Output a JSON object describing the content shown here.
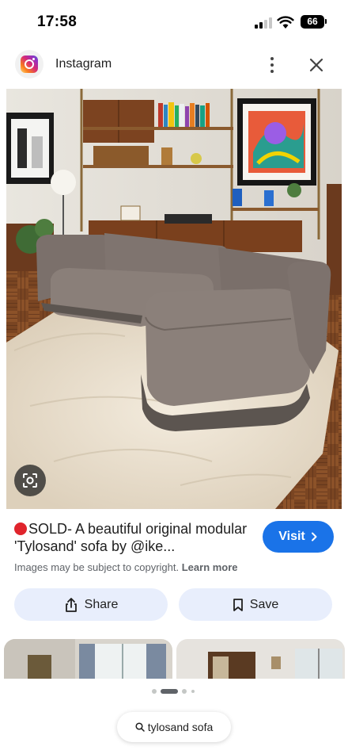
{
  "status_bar": {
    "time": "17:58",
    "battery": "66"
  },
  "source": {
    "name": "Instagram",
    "logo_icon": "instagram-logo"
  },
  "result": {
    "title": "SOLD- A beautiful original modular 'Tylosand' sofa by @ike...",
    "visit_label": "Visit",
    "copyright_text": "Images may be subject to copyright.",
    "learn_more_label": "Learn more"
  },
  "actions": {
    "share_label": "Share",
    "save_label": "Save"
  },
  "search": {
    "query": "tylosand sofa"
  },
  "colors": {
    "accent": "#1a73e8",
    "pill_bg": "#e8eefc",
    "sold_dot": "#e0242c"
  }
}
